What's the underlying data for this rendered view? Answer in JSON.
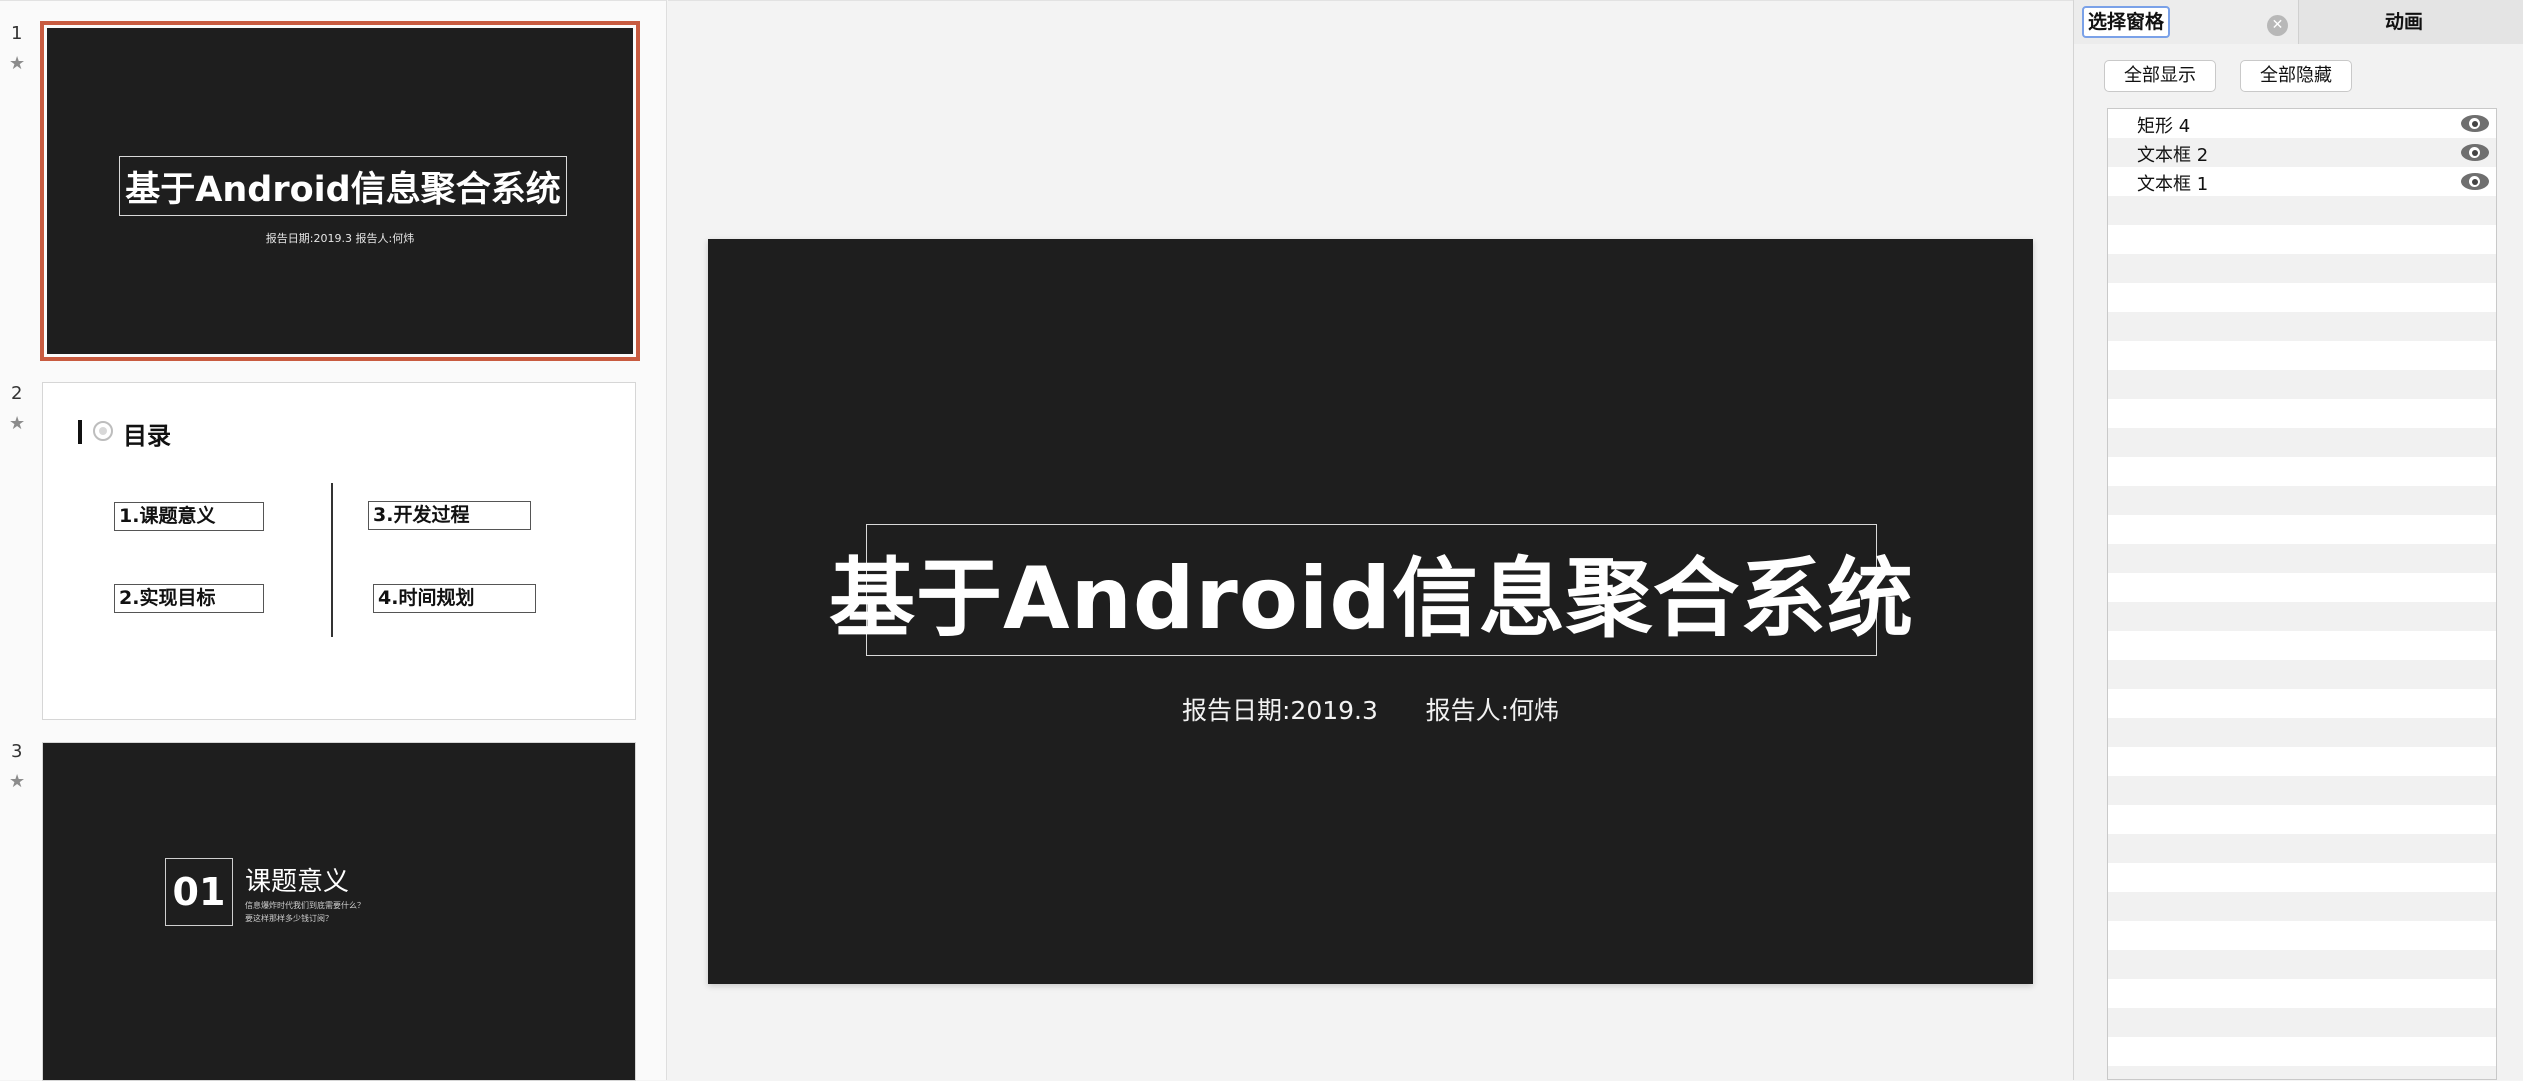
{
  "thumbnails": [
    {
      "number": "1",
      "title": "基于Android信息聚合系统",
      "subtitle": "报告日期:2019.3     报告人:何炜"
    },
    {
      "number": "2",
      "heading": "目录",
      "items": [
        "1.课题意义",
        "3.开发过程",
        "2.实现目标",
        "4.时间规划"
      ]
    },
    {
      "number": "3",
      "num_label": "01",
      "title": "课题意义",
      "lines": [
        "信息爆炸时代我们到底需要什么？",
        "要这样那样多少钱订阅？"
      ]
    }
  ],
  "main_slide": {
    "title": "基于Android信息聚合系统",
    "subtitle": "报告日期:2019.3      报告人:何炜"
  },
  "selection_pane": {
    "tab_selection": "选择窗格",
    "tab_animation": "动画",
    "show_all": "全部显示",
    "hide_all": "全部隐藏",
    "layers": [
      "矩形 4",
      "文本框 2",
      "文本框 1"
    ]
  },
  "colors": {
    "selected_border": "#c85b40",
    "slide_background": "#1e1e1e",
    "tab_focus": "#7aa1e8"
  },
  "icons": {
    "star": "star-icon",
    "close": "close-icon",
    "visibility": "eye-icon"
  }
}
